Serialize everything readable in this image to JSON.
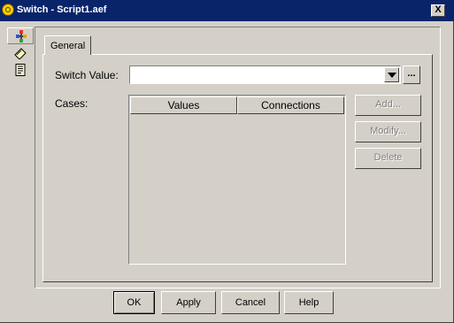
{
  "window": {
    "title": "Switch - Script1.aef",
    "close_label": "X"
  },
  "side_toolbar": {
    "icons": [
      "general-properties-icon",
      "label-tag-icon",
      "document-icon"
    ]
  },
  "tabs": [
    {
      "label": "General"
    }
  ],
  "form": {
    "switch_value_label": "Switch Value:",
    "switch_value": "",
    "ellipsis_label": "...",
    "cases_label": "Cases:"
  },
  "cases_table": {
    "columns": [
      "Values",
      "Connections"
    ],
    "rows": []
  },
  "case_buttons": {
    "add": "Add...",
    "modify": "Modify...",
    "delete": "Delete"
  },
  "dialog_buttons": {
    "ok": "OK",
    "apply": "Apply",
    "cancel": "Cancel",
    "help": "Help"
  },
  "colors": {
    "titlebar": "#0a246a",
    "face": "#d4d0c8",
    "disabled_text": "#808080"
  }
}
